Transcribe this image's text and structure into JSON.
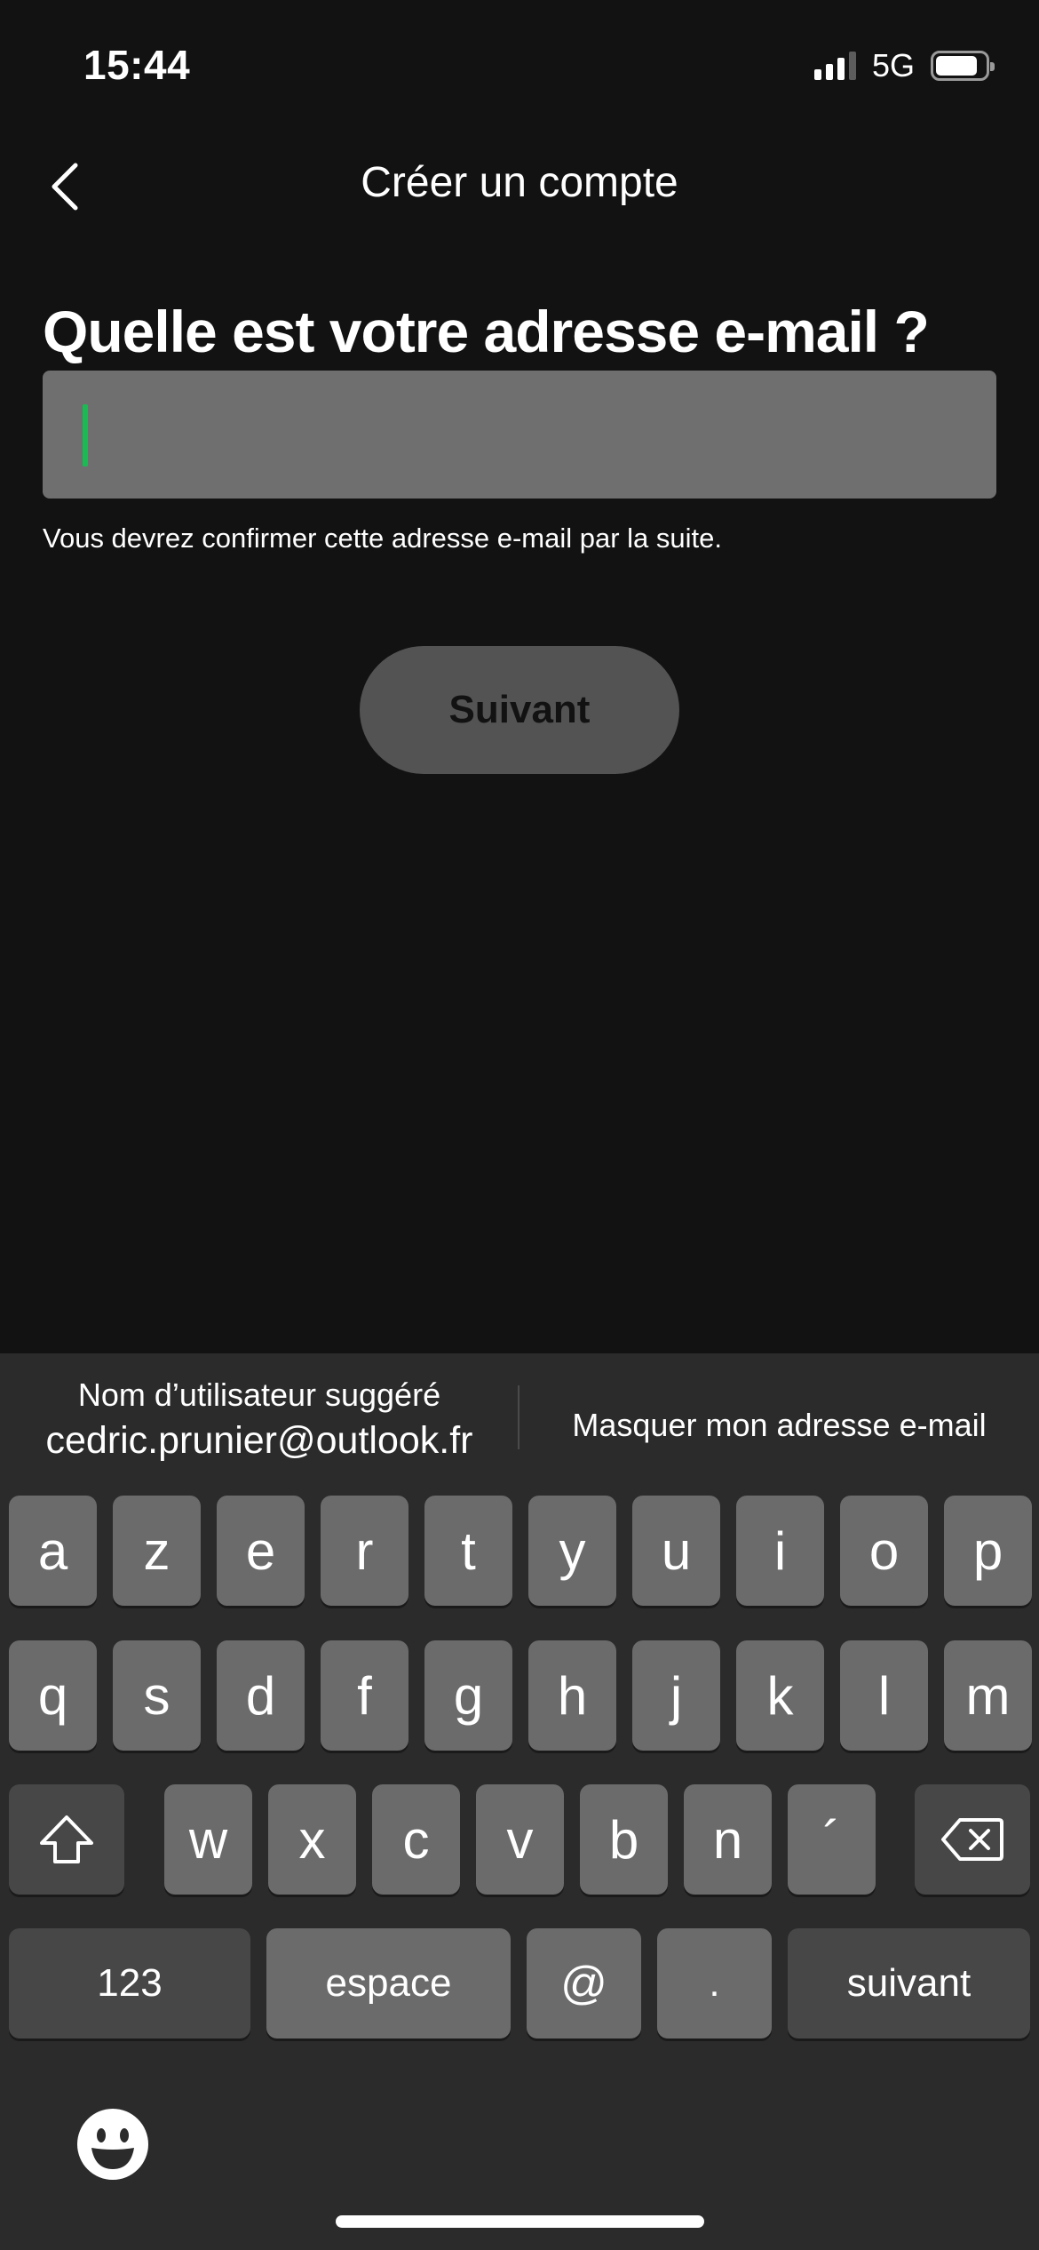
{
  "status_bar": {
    "time": "15:44",
    "network": "5G"
  },
  "header": {
    "title": "Créer un compte"
  },
  "form": {
    "question": "Quelle est votre adresse e-mail ?",
    "email_value": "",
    "helper": "Vous devrez confirmer cette adresse e-mail par la suite.",
    "next_label": "Suivant"
  },
  "keyboard": {
    "suggestion_caption": "Nom d’utilisateur suggéré",
    "suggestion_email": "cedric.prunier@outlook.fr",
    "hide_email": "Masquer mon adresse e-mail",
    "row1": [
      "a",
      "z",
      "e",
      "r",
      "t",
      "y",
      "u",
      "i",
      "o",
      "p"
    ],
    "row2": [
      "q",
      "s",
      "d",
      "f",
      "g",
      "h",
      "j",
      "k",
      "l",
      "m"
    ],
    "row3": [
      "w",
      "x",
      "c",
      "v",
      "b",
      "n",
      "´"
    ],
    "numbers_label": "123",
    "space_label": "espace",
    "at_label": "@",
    "dot_label": ".",
    "return_label": "suivant"
  },
  "colors": {
    "background": "#121212",
    "accent": "#1db954",
    "button": "#535353"
  },
  "icons": [
    "back-chevron-icon",
    "signal-icon",
    "battery-icon",
    "shift-icon",
    "backspace-icon",
    "emoji-icon"
  ]
}
